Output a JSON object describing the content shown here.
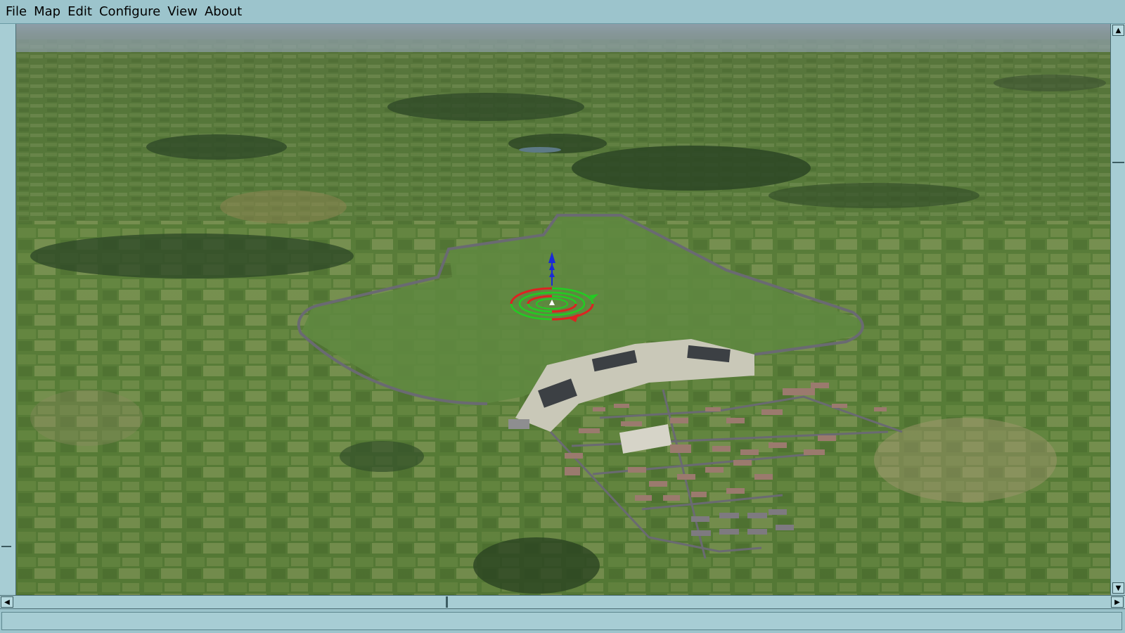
{
  "menu": {
    "items": [
      "File",
      "Map",
      "Edit",
      "Configure",
      "View",
      "About"
    ]
  },
  "viewport": {
    "description_icon": "3d-scenery-view",
    "object_marker": "object-placement-gizmo"
  },
  "scrollbars": {
    "up_icon": "arrow-up-icon",
    "down_icon": "arrow-down-icon",
    "left_icon": "arrow-left-icon",
    "right_icon": "arrow-right-icon"
  },
  "status": {
    "text": ""
  },
  "colors": {
    "chrome": "#9cc4cc",
    "terrain": "#547a34",
    "gizmo_green": "#22cc22",
    "gizmo_red": "#dd2222",
    "gizmo_blue": "#1a2ad8"
  }
}
